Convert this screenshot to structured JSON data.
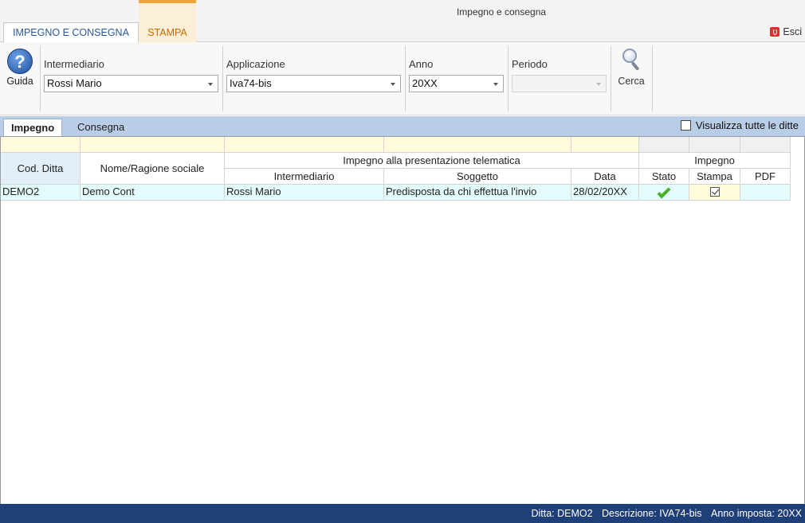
{
  "window": {
    "title": "Impegno e consegna"
  },
  "ribbon": {
    "tabs": [
      {
        "label": "IMPEGNO E CONSEGNA"
      },
      {
        "label": "STAMPA"
      }
    ],
    "esci_label": "Esci",
    "guida_label": "Guida",
    "cerca_label": "Cerca",
    "fields": {
      "intermediario": {
        "label": "Intermediario",
        "value": "Rossi Mario"
      },
      "applicazione": {
        "label": "Applicazione",
        "value": "Iva74-bis"
      },
      "anno": {
        "label": "Anno",
        "value": "20XX"
      },
      "periodo": {
        "label": "Periodo",
        "value": ""
      }
    }
  },
  "subtabs": [
    {
      "label": "Impegno"
    },
    {
      "label": "Consegna"
    }
  ],
  "visualizza_label": "Visualizza tutte le ditte",
  "grid": {
    "headers": {
      "cod_ditta": "Cod. Ditta",
      "nome": "Nome/Ragione sociale",
      "group_telematica": "Impegno alla presentazione telematica",
      "intermediario": "Intermediario",
      "soggetto": "Soggetto",
      "data": "Data",
      "group_impegno": "Impegno",
      "stato": "Stato",
      "stampa": "Stampa",
      "pdf": "PDF"
    },
    "rows": [
      {
        "cod_ditta": "DEMO2",
        "nome": "Demo Cont",
        "intermediario": "Rossi Mario",
        "soggetto": "Predisposta da chi effettua l'invio",
        "data": "28/02/20XX",
        "stato": "ok",
        "stampa": true,
        "pdf": ""
      }
    ]
  },
  "statusbar": {
    "ditta": "Ditta: DEMO2",
    "descrizione": "Descrizione: IVA74-bis",
    "anno": "Anno imposta: 20XX"
  },
  "colors": {
    "accent_blue": "#2b579a",
    "stampa_orange": "#f2a33a",
    "statusbar": "#1f3f78",
    "row_bg": "#e3fbfb",
    "filter_bg": "#fffbdc"
  }
}
